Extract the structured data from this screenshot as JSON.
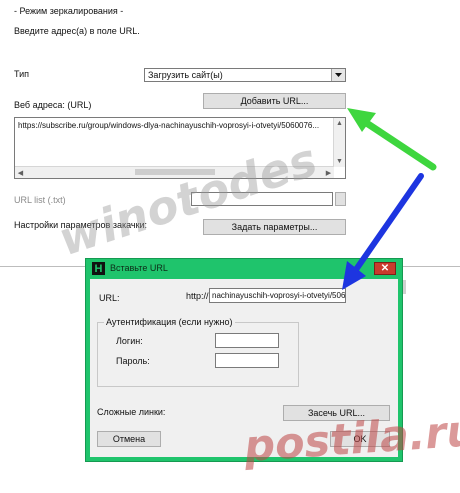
{
  "section_title": "- Режим зеркалирования -",
  "instruction": "Введите адрес(а) в поле URL.",
  "type_label": "Тип",
  "type_select": "Загрузить сайт(ы)",
  "web_addresses_label": "Веб адреса: (URL)",
  "add_url_button": "Добавить URL...",
  "url_list_value": "https://subscribe.ru/group/windows-dlya-nachinayuschih-voprosyi-i-otvetyi/5060076...",
  "url_list_file_label": "URL list (.txt)",
  "download_settings_label": "Настройки параметров закачки:",
  "set_params_button": "Задать параметры...",
  "dialog": {
    "title": "Вставьте URL",
    "url_label": "URL:",
    "url_prefix": "http://",
    "url_value": "nachinayuschih-voprosyi-i-otvetyi/5060076:",
    "auth_group": "Аутентификация (если нужно)",
    "login_label": "Логин:",
    "password_label": "Пароль:",
    "complex_links_label": "Сложные линки:",
    "capture_url_button": "Засечь URL...",
    "cancel_button": "Отмена",
    "ok_button": "OK"
  },
  "watermark_1": "winotodes",
  "watermark_2": "postila.ru",
  "icons": [
    "dropdown-arrow-icon",
    "scroll-up-icon",
    "scroll-down-icon",
    "scroll-left-icon",
    "scroll-right-icon",
    "app-logo-icon",
    "close-icon",
    "green-arrow-icon",
    "blue-arrow-icon"
  ],
  "colors": {
    "dialog_frame": "#1fc46c",
    "close_button": "#c93a2d",
    "green_arrow": "#3ed63e",
    "blue_arrow": "#1d35e0",
    "watermark_red": "#be4646"
  }
}
